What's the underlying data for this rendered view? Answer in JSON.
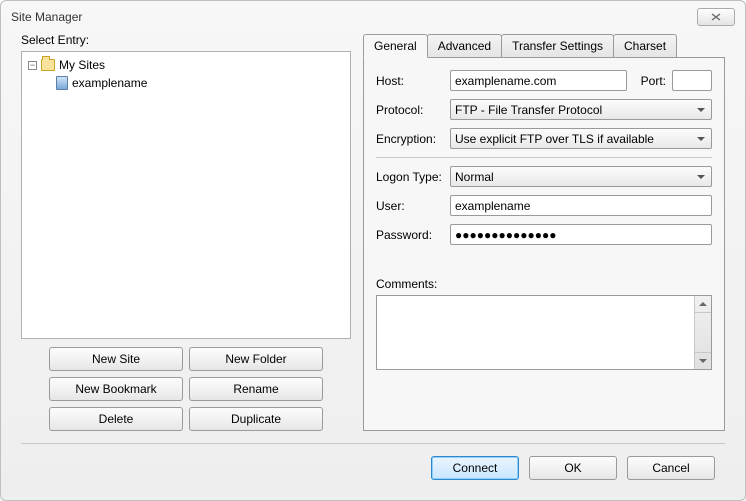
{
  "window": {
    "title": "Site Manager"
  },
  "left": {
    "select_entry_label": "Select Entry:",
    "root_label": "My Sites",
    "child_label": "examplename",
    "buttons": {
      "new_site": "New Site",
      "new_folder": "New Folder",
      "new_bookmark": "New Bookmark",
      "rename": "Rename",
      "delete": "Delete",
      "duplicate": "Duplicate"
    }
  },
  "tabs": {
    "general": "General",
    "advanced": "Advanced",
    "transfer": "Transfer Settings",
    "charset": "Charset"
  },
  "general": {
    "host_label": "Host:",
    "host_value": "examplename.com",
    "port_label": "Port:",
    "port_value": "",
    "protocol_label": "Protocol:",
    "protocol_value": "FTP - File Transfer Protocol",
    "encryption_label": "Encryption:",
    "encryption_value": "Use explicit FTP over TLS if available",
    "logon_type_label": "Logon Type:",
    "logon_type_value": "Normal",
    "user_label": "User:",
    "user_value": "examplename",
    "password_label": "Password:",
    "password_value": "●●●●●●●●●●●●●●",
    "comments_label": "Comments:"
  },
  "footer": {
    "connect": "Connect",
    "ok": "OK",
    "cancel": "Cancel"
  }
}
